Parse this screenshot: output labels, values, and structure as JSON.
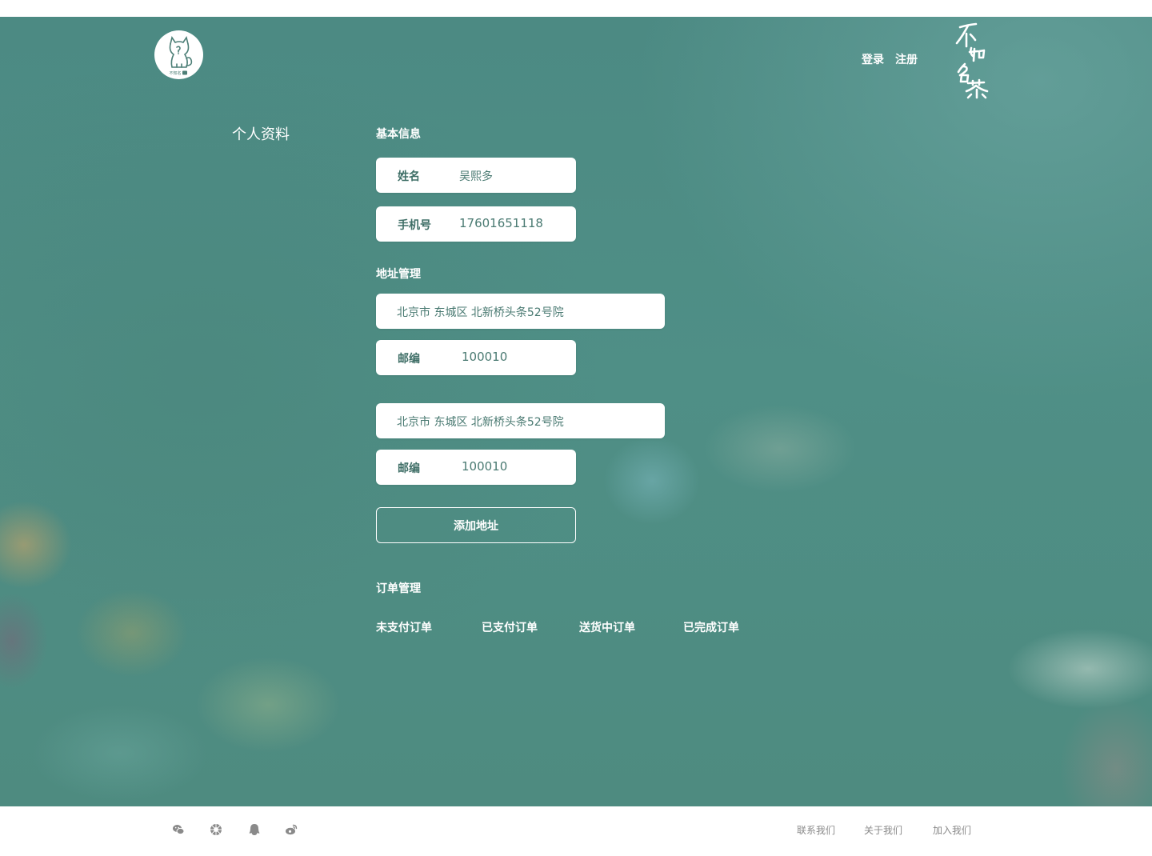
{
  "header": {
    "nav": {
      "login": "登录",
      "register": "注册"
    },
    "logo_icon": "cat-logo-icon",
    "logo_text": "不知名茶",
    "brand_script_text": "不知名茶"
  },
  "sidebar": {
    "title": "个人资料"
  },
  "basic_info": {
    "title": "基本信息",
    "name_label": "姓名",
    "name_value": "吴熙多",
    "phone_label": "手机号",
    "phone_value": "17601651118"
  },
  "address": {
    "title": "地址管理",
    "items": [
      {
        "address": "北京市 东城区 北新桥头条52号院",
        "zip_label": "邮编",
        "zip": "100010"
      },
      {
        "address": "北京市 东城区 北新桥头条52号院",
        "zip_label": "邮编",
        "zip": "100010"
      }
    ],
    "add_button": "添加地址"
  },
  "orders": {
    "title": "订单管理",
    "tabs": [
      "未支付订单",
      "已支付订单",
      "送货中订单",
      "已完成订单"
    ]
  },
  "footer": {
    "social_icons": [
      "wechat-icon",
      "moments-icon",
      "qq-icon",
      "weibo-icon"
    ],
    "links": [
      "联系我们",
      "关于我们",
      "加入我们"
    ]
  },
  "colors": {
    "teal_bg": "#4e8b80",
    "text_teal": "#4a7a72",
    "white": "#ffffff",
    "footer_link": "#8a8a8a"
  }
}
